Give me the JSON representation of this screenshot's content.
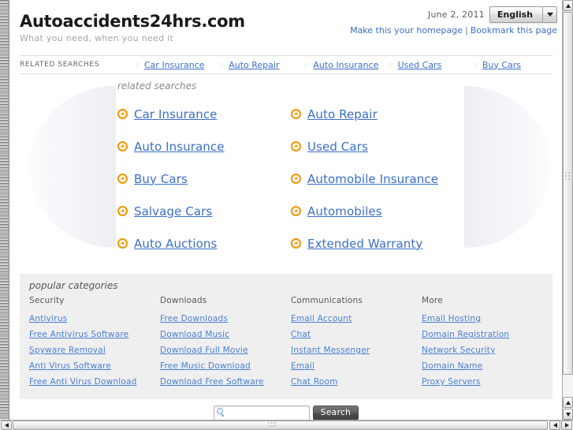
{
  "header": {
    "site_title": "Autoaccidents24hrs.com",
    "tagline": "What you need, when you need it",
    "date": "June 2, 2011",
    "language": "English",
    "homepage_link": "Make this your homepage",
    "link_separator": "|",
    "bookmark_link": "Bookmark this page"
  },
  "nav": {
    "label": "RELATED SEARCHES",
    "items": [
      {
        "label": "Car Insurance"
      },
      {
        "label": "Auto Repair"
      },
      {
        "label": "Auto Insurance"
      },
      {
        "label": "Used Cars"
      },
      {
        "label": "Buy Cars"
      }
    ]
  },
  "main": {
    "caption": "related searches",
    "links": [
      {
        "label": "Car Insurance"
      },
      {
        "label": "Auto Repair"
      },
      {
        "label": "Auto Insurance"
      },
      {
        "label": "Used Cars"
      },
      {
        "label": "Buy Cars"
      },
      {
        "label": "Automobile Insurance"
      },
      {
        "label": "Salvage Cars"
      },
      {
        "label": "Automobiles"
      },
      {
        "label": "Auto Auctions"
      },
      {
        "label": "Extended Warranty"
      }
    ]
  },
  "categories": {
    "caption": "popular categories",
    "columns": [
      {
        "heading": "Security",
        "links": [
          "Antivirus",
          "Free Antivirus Software",
          "Spyware Removal",
          "Anti Virus Software",
          "Free Anti Virus Download"
        ]
      },
      {
        "heading": "Downloads",
        "links": [
          "Free Downloads",
          "Download Music",
          "Download Full Movie",
          "Free Music Download",
          "Download Free Software"
        ]
      },
      {
        "heading": "Communications",
        "links": [
          "Email Account",
          "Chat",
          "Instant Messenger",
          "Email",
          "Chat Room"
        ]
      },
      {
        "heading": "More",
        "links": [
          "Email Hosting",
          "Domain Registration",
          "Network Security",
          "Domain Name",
          "Proxy Servers"
        ]
      }
    ]
  },
  "search": {
    "value": "",
    "placeholder": "",
    "button_label": "Search",
    "icon": "magnifier-icon"
  },
  "colors": {
    "link_blue": "#3b6fc9",
    "arrow_orange": "#f29500",
    "category_panel": "#efefef",
    "muted_text": "#8b8b8b"
  }
}
